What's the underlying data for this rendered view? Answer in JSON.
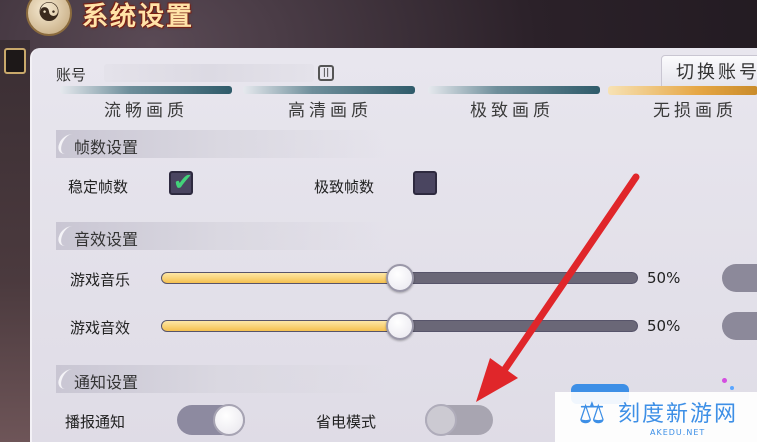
{
  "header": {
    "title": "系统设置",
    "emblem_icon": "yin-yang-icon"
  },
  "account": {
    "label": "账号",
    "icon": "id-card-icon",
    "switch_label": "切换账号"
  },
  "quality": {
    "options": [
      {
        "label": "流畅画质",
        "active": false
      },
      {
        "label": "高清画质",
        "active": false
      },
      {
        "label": "极致画质",
        "active": false
      },
      {
        "label": "无损画质",
        "active": true
      }
    ]
  },
  "framerate": {
    "title": "帧数设置",
    "stable": {
      "label": "稳定帧数",
      "checked": true
    },
    "extreme": {
      "label": "极致帧数",
      "checked": false
    }
  },
  "sound": {
    "title": "音效设置",
    "music": {
      "label": "游戏音乐",
      "value": 50,
      "value_text": "50%"
    },
    "effects": {
      "label": "游戏音效",
      "value": 50,
      "value_text": "50%"
    }
  },
  "notify": {
    "title": "通知设置",
    "broadcast": {
      "label": "播报通知",
      "on": true
    },
    "power_save": {
      "label": "省电模式",
      "on": false
    }
  },
  "watermark": {
    "name": "刻度新游网",
    "url": "AKEDU.NET"
  },
  "colors": {
    "accent_gold": "#f5c04f",
    "check_green": "#43d27a",
    "arrow_red": "#e0262a",
    "watermark_blue": "#3d8fe6"
  }
}
